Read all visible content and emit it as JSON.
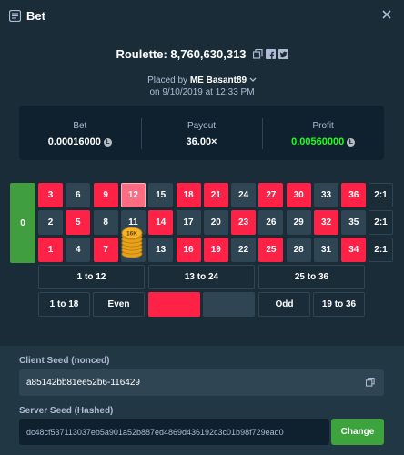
{
  "header": {
    "title": "Bet"
  },
  "game": {
    "title": "Roulette: 8,760,630,313"
  },
  "placed": {
    "prefix": "Placed by",
    "rank": "ME",
    "user": "Basant89",
    "date": "on 9/10/2019 at 12:33 PM"
  },
  "stats": {
    "bet_label": "Bet",
    "bet_value": "0.00016000",
    "payout_label": "Payout",
    "payout_value": "36.00×",
    "profit_label": "Profit",
    "profit_value": "0.00560000",
    "coin_symbol": "Ł"
  },
  "board": {
    "zero": "0",
    "rows": [
      [
        {
          "n": "3",
          "c": "red"
        },
        {
          "n": "6",
          "c": "black"
        },
        {
          "n": "9",
          "c": "red"
        },
        {
          "n": "12",
          "c": "red",
          "selected": true
        },
        {
          "n": "15",
          "c": "black"
        },
        {
          "n": "18",
          "c": "red"
        },
        {
          "n": "21",
          "c": "red"
        },
        {
          "n": "24",
          "c": "black"
        },
        {
          "n": "27",
          "c": "red"
        },
        {
          "n": "30",
          "c": "red"
        },
        {
          "n": "33",
          "c": "black"
        },
        {
          "n": "36",
          "c": "red"
        }
      ],
      [
        {
          "n": "2",
          "c": "black"
        },
        {
          "n": "5",
          "c": "red"
        },
        {
          "n": "8",
          "c": "black"
        },
        {
          "n": "11",
          "c": "black"
        },
        {
          "n": "14",
          "c": "red"
        },
        {
          "n": "17",
          "c": "black"
        },
        {
          "n": "20",
          "c": "black"
        },
        {
          "n": "23",
          "c": "red"
        },
        {
          "n": "26",
          "c": "black"
        },
        {
          "n": "29",
          "c": "black"
        },
        {
          "n": "32",
          "c": "red"
        },
        {
          "n": "35",
          "c": "black"
        }
      ],
      [
        {
          "n": "1",
          "c": "red"
        },
        {
          "n": "4",
          "c": "black"
        },
        {
          "n": "7",
          "c": "red"
        },
        {
          "n": "10",
          "c": "black"
        },
        {
          "n": "13",
          "c": "black"
        },
        {
          "n": "16",
          "c": "red"
        },
        {
          "n": "19",
          "c": "red"
        },
        {
          "n": "22",
          "c": "black"
        },
        {
          "n": "25",
          "c": "red"
        },
        {
          "n": "28",
          "c": "black"
        },
        {
          "n": "31",
          "c": "black"
        },
        {
          "n": "34",
          "c": "red"
        }
      ]
    ],
    "column_bets": [
      "2:1",
      "2:1",
      "2:1"
    ],
    "dozens": [
      "1 to 12",
      "13 to 24",
      "25 to 36"
    ],
    "outside": [
      "1 to 18",
      "Even",
      "",
      "",
      "Odd",
      "19 to 36"
    ],
    "chip_label": "16K"
  },
  "seeds": {
    "client_label": "Client Seed (nonced)",
    "client_value": "a85142bb81ee52b6-116429",
    "server_label": "Server Seed (Hashed)",
    "server_value": "dc48cf537113037eb5a901a52b887ed4869d436192c3c01b98f729ead0",
    "change_label": "Change"
  }
}
